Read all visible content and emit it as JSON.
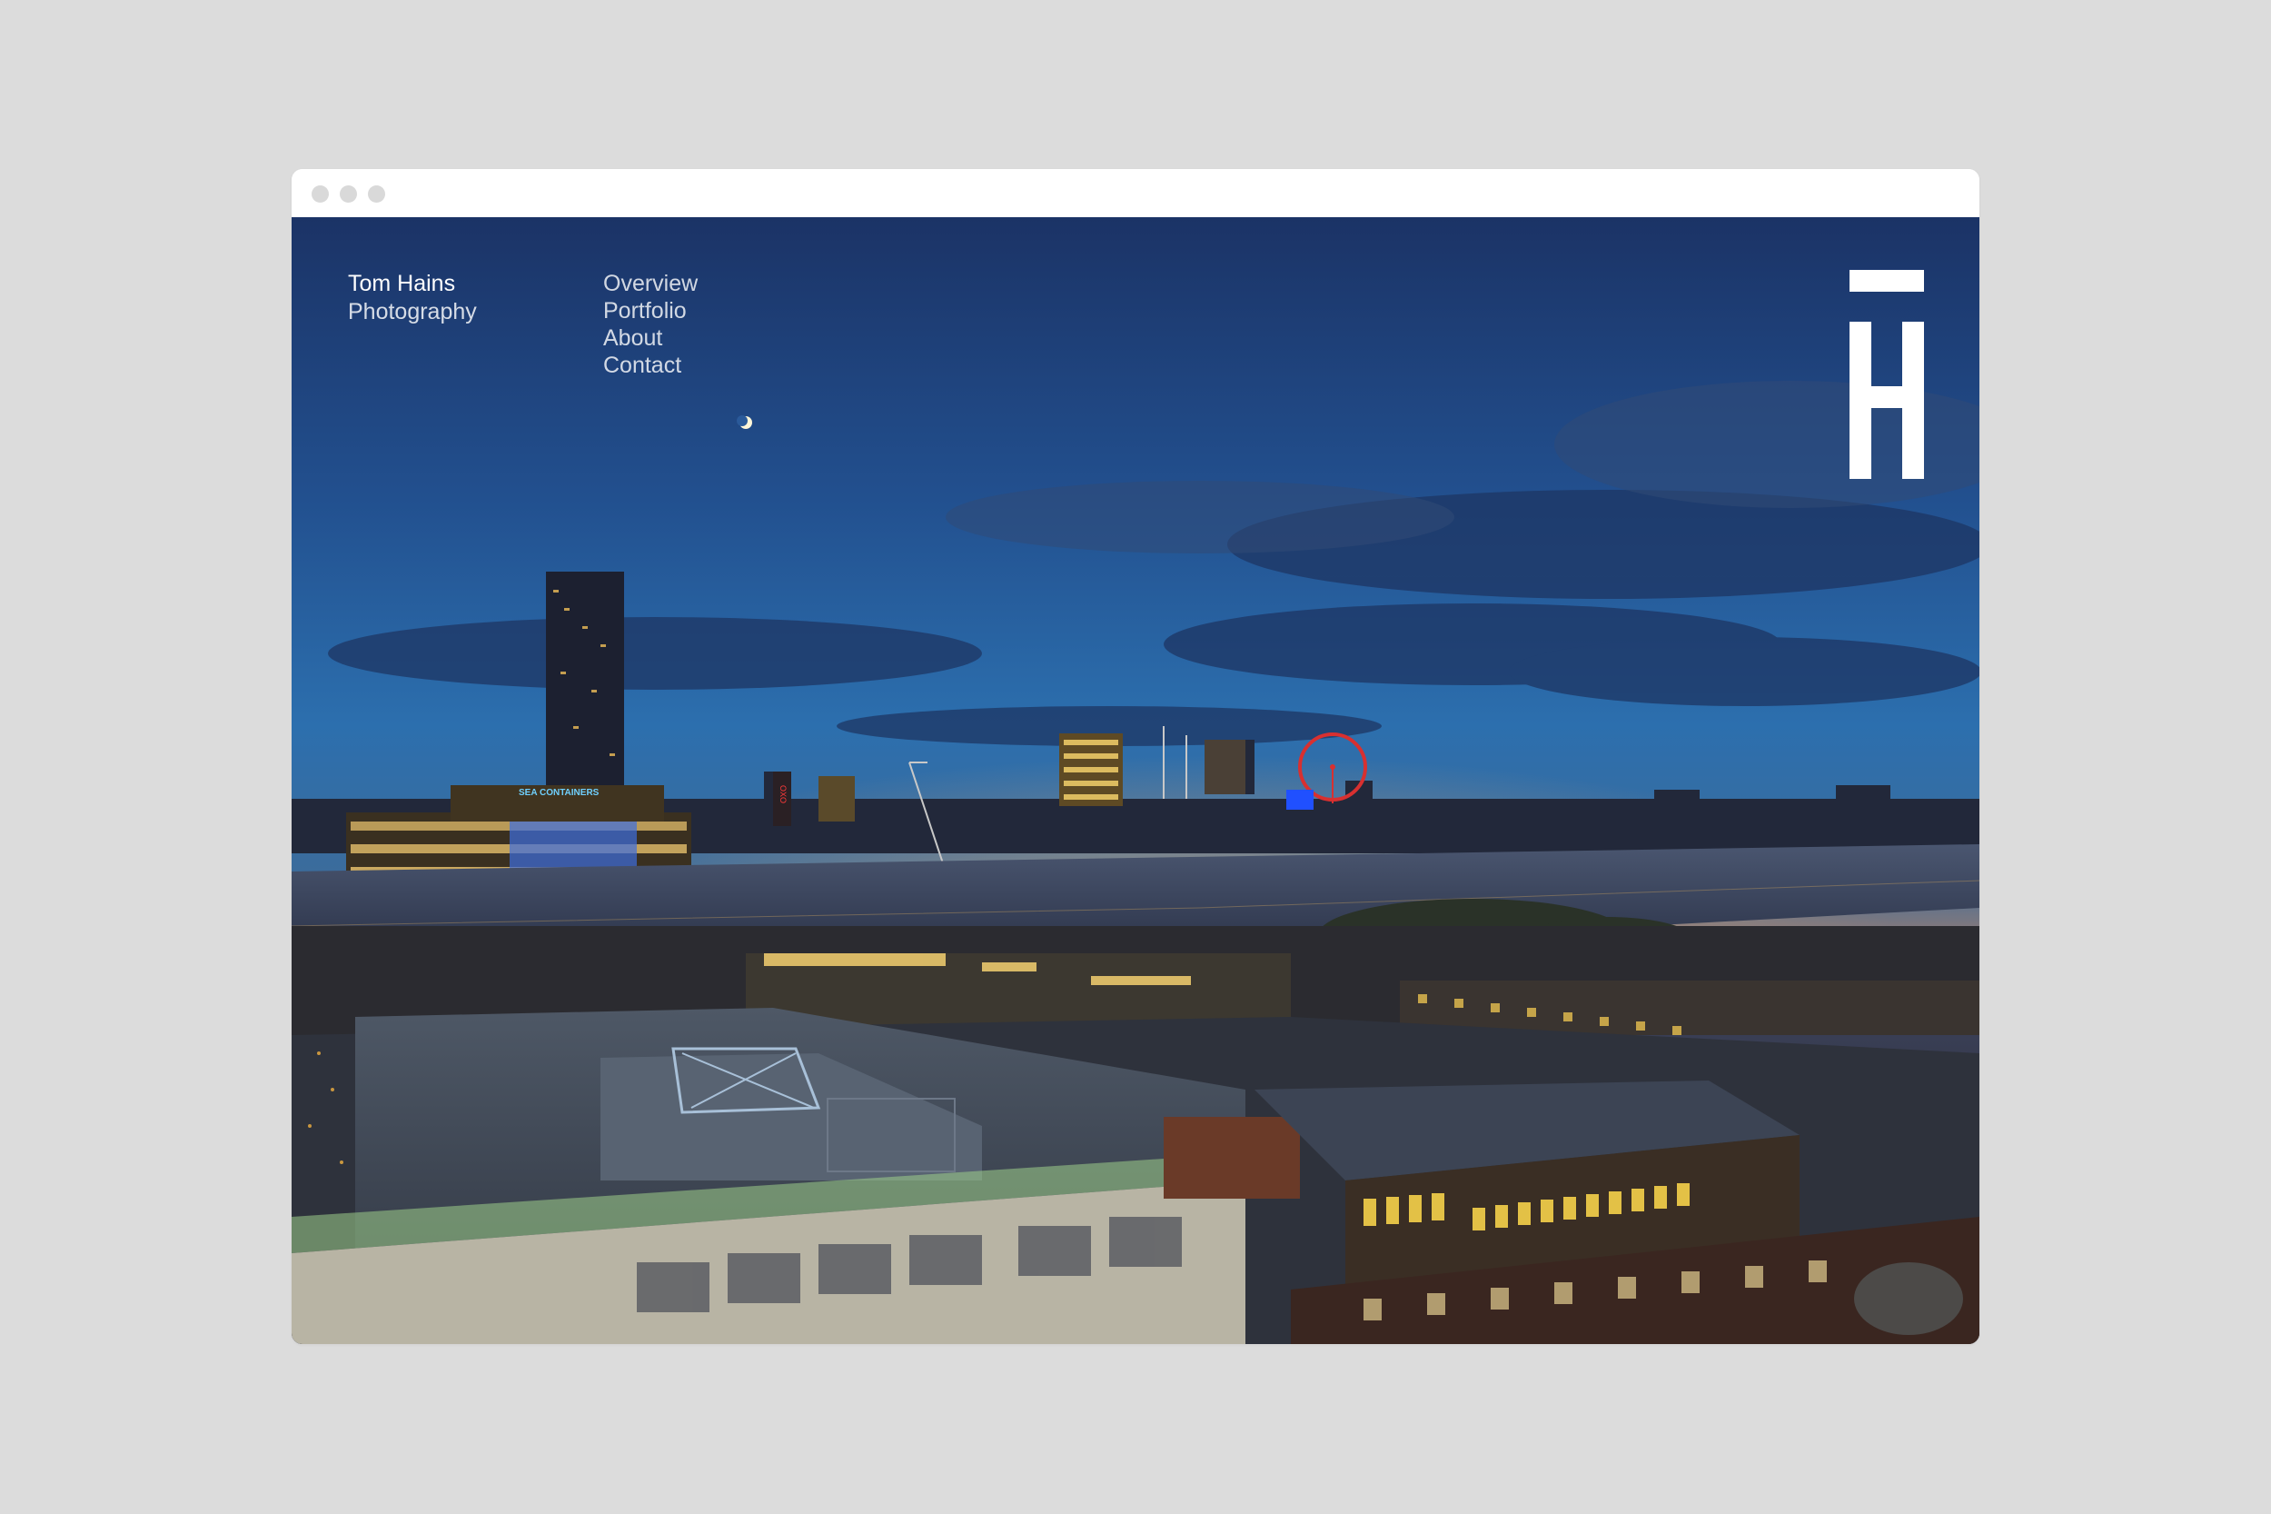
{
  "brand": {
    "name": "Tom Hains",
    "tagline": "Photography"
  },
  "nav": {
    "items": [
      {
        "label": "Overview"
      },
      {
        "label": "Portfolio"
      },
      {
        "label": "About"
      },
      {
        "label": "Contact"
      }
    ]
  },
  "logo": {
    "icon": "h-monogram-icon"
  },
  "hero": {
    "subject": "city-skyline-photo",
    "sign_text": "SEA CONTAINERS",
    "vertical_sign": "OXO"
  },
  "colors": {
    "page_background": "#dcdcdc",
    "window_chrome": "#ffffff",
    "traffic_dot": "#d9d9d9",
    "sky_top": "#1e3c78",
    "sky_mid": "#2b6fb3",
    "horizon_glow": "#e09a5a",
    "nav_text": "#ffffff"
  }
}
